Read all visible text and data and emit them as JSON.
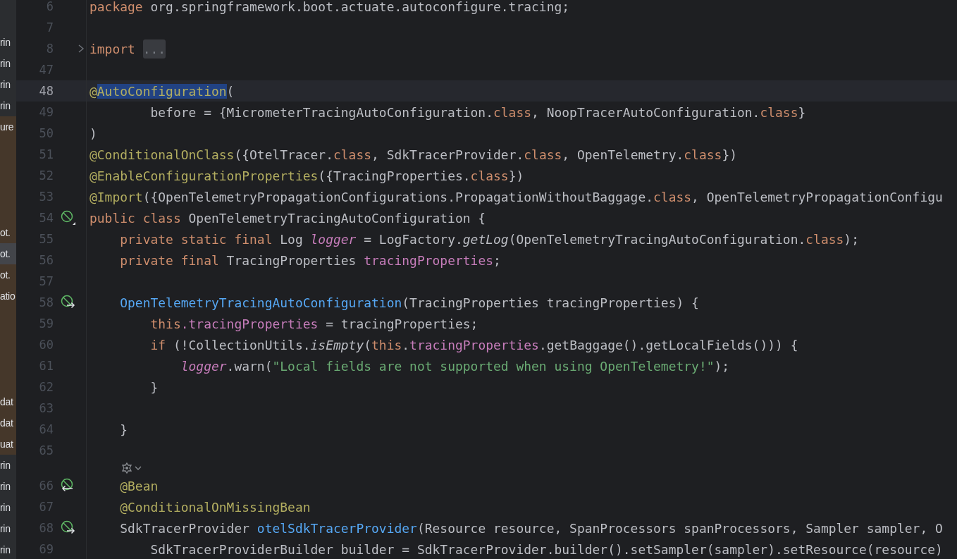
{
  "project_strip": {
    "items": [
      {
        "tinted": false,
        "selected": false
      },
      {
        "tinted": false,
        "selected": false
      },
      {
        "text": "rin",
        "tinted": false,
        "selected": false
      },
      {
        "text": "rin",
        "tinted": false,
        "selected": false
      },
      {
        "text": "rin",
        "tinted": false,
        "selected": false
      },
      {
        "text": "rin",
        "tinted": false,
        "selected": false
      },
      {
        "text": "ure",
        "tinted": true,
        "selected": false
      },
      {
        "tinted": true,
        "selected": false
      },
      {
        "tinted": true,
        "selected": false
      },
      {
        "tinted": true,
        "selected": false
      },
      {
        "tinted": true,
        "selected": false
      },
      {
        "text": "ot.",
        "tinted": true,
        "selected": false
      },
      {
        "text": "ot.",
        "tinted": true,
        "selected": true
      },
      {
        "text": "ot.",
        "tinted": true,
        "selected": false
      },
      {
        "text": "atio",
        "tinted": true,
        "selected": false
      },
      {
        "tinted": true,
        "selected": false
      },
      {
        "tinted": true,
        "selected": false
      },
      {
        "tinted": true,
        "selected": false
      },
      {
        "tinted": true,
        "selected": false
      },
      {
        "text": "dat",
        "tinted": true,
        "selected": false
      },
      {
        "text": "dat",
        "tinted": true,
        "selected": false
      },
      {
        "text": "uat",
        "tinted": true,
        "selected": false
      },
      {
        "text": "rin",
        "tinted": false,
        "selected": false
      },
      {
        "text": "rin",
        "tinted": false,
        "selected": false
      },
      {
        "text": "rin",
        "tinted": false,
        "selected": false
      },
      {
        "text": "rin",
        "tinted": false,
        "selected": false
      },
      {
        "text": "rin",
        "tinted": false,
        "selected": false
      }
    ]
  },
  "editor": {
    "lines": [
      {
        "kind": "code",
        "number": "6",
        "current": false,
        "tokens": [
          {
            "text": "package ",
            "kind": "kw"
          },
          {
            "text": "org.springframework.boot.actuate.autoconfigure.tracing;",
            "kind": "plain"
          }
        ]
      },
      {
        "kind": "code",
        "number": "7",
        "current": false
      },
      {
        "kind": "code",
        "number": "8",
        "current": false,
        "folded": true,
        "tokens": [
          {
            "text": "import ",
            "kind": "kw"
          },
          {
            "text": "...",
            "kind": "fold"
          }
        ]
      },
      {
        "kind": "code",
        "number": "47",
        "current": false
      },
      {
        "kind": "code",
        "number": "48",
        "current": true,
        "tokens": [
          {
            "text": "@",
            "kind": "ann"
          },
          {
            "text": "AutoConfiguration",
            "kind": "ann",
            "selected": true
          },
          {
            "text": "(",
            "kind": "plain"
          }
        ]
      },
      {
        "kind": "code",
        "number": "49",
        "current": false,
        "tokens": [
          {
            "text": "        before = {MicrometerTracingAutoConfiguration.",
            "kind": "plain"
          },
          {
            "text": "class",
            "kind": "kw"
          },
          {
            "text": ", NoopTracerAutoConfiguration.",
            "kind": "plain"
          },
          {
            "text": "class",
            "kind": "kw"
          },
          {
            "text": "}",
            "kind": "plain"
          }
        ]
      },
      {
        "kind": "code",
        "number": "50",
        "current": false,
        "tokens": [
          {
            "text": ")",
            "kind": "plain"
          }
        ]
      },
      {
        "kind": "code",
        "number": "51",
        "current": false,
        "tokens": [
          {
            "text": "@ConditionalOnClass",
            "kind": "ann"
          },
          {
            "text": "({OtelTracer.",
            "kind": "plain"
          },
          {
            "text": "class",
            "kind": "kw"
          },
          {
            "text": ", SdkTracerProvider.",
            "kind": "plain"
          },
          {
            "text": "class",
            "kind": "kw"
          },
          {
            "text": ", OpenTelemetry.",
            "kind": "plain"
          },
          {
            "text": "class",
            "kind": "kw"
          },
          {
            "text": "})",
            "kind": "plain"
          }
        ]
      },
      {
        "kind": "code",
        "number": "52",
        "current": false,
        "tokens": [
          {
            "text": "@EnableConfigurationProperties",
            "kind": "ann"
          },
          {
            "text": "({TracingProperties.",
            "kind": "plain"
          },
          {
            "text": "class",
            "kind": "kw"
          },
          {
            "text": "})",
            "kind": "plain"
          }
        ]
      },
      {
        "kind": "code",
        "number": "53",
        "current": false,
        "tokens": [
          {
            "text": "@Import",
            "kind": "ann"
          },
          {
            "text": "({OpenTelemetryPropagationConfigurations.PropagationWithoutBaggage.",
            "kind": "plain"
          },
          {
            "text": "class",
            "kind": "kw"
          },
          {
            "text": ", OpenTelemetryPropagationConfigu",
            "kind": "plain"
          }
        ]
      },
      {
        "kind": "code",
        "number": "54",
        "current": false,
        "gutter": {
          "kind": "bean"
        },
        "tokens": [
          {
            "text": "public class ",
            "kind": "kw"
          },
          {
            "text": "OpenTelemetryTracingAutoConfiguration {",
            "kind": "plain"
          }
        ]
      },
      {
        "kind": "code",
        "number": "55",
        "current": false,
        "tokens": [
          {
            "text": "    private static final ",
            "kind": "kw"
          },
          {
            "text": "Log ",
            "kind": "plain"
          },
          {
            "text": "logger",
            "kind": "static_field"
          },
          {
            "text": " = LogFactory.",
            "kind": "plain"
          },
          {
            "text": "getLog",
            "kind": "static_call"
          },
          {
            "text": "(OpenTelemetryTracingAutoConfiguration.",
            "kind": "plain"
          },
          {
            "text": "class",
            "kind": "kw"
          },
          {
            "text": ");",
            "kind": "plain"
          }
        ]
      },
      {
        "kind": "code",
        "number": "56",
        "current": false,
        "tokens": [
          {
            "text": "    private final ",
            "kind": "kw"
          },
          {
            "text": "TracingProperties ",
            "kind": "plain"
          },
          {
            "text": "tracingProperties",
            "kind": "field"
          },
          {
            "text": ";",
            "kind": "plain"
          }
        ]
      },
      {
        "kind": "code",
        "number": "57",
        "current": false
      },
      {
        "kind": "code",
        "number": "58",
        "current": false,
        "gutter": {
          "kind": "bean_out"
        },
        "tokens": [
          {
            "text": "    OpenTelemetryTracingAutoConfiguration",
            "kind": "decl"
          },
          {
            "text": "(TracingProperties tracingProperties) {",
            "kind": "plain"
          }
        ]
      },
      {
        "kind": "code",
        "number": "59",
        "current": false,
        "tokens": [
          {
            "text": "        this",
            "kind": "kw"
          },
          {
            "text": ".tracingProperties",
            "kind": "field"
          },
          {
            "text": " = tracingProperties;",
            "kind": "plain"
          }
        ]
      },
      {
        "kind": "code",
        "number": "60",
        "current": false,
        "tokens": [
          {
            "text": "        if ",
            "kind": "kw"
          },
          {
            "text": "(!CollectionUtils.",
            "kind": "plain"
          },
          {
            "text": "isEmpty",
            "kind": "static_call"
          },
          {
            "text": "(",
            "kind": "plain"
          },
          {
            "text": "this",
            "kind": "kw"
          },
          {
            "text": ".",
            "kind": "plain"
          },
          {
            "text": "tracingProperties",
            "kind": "field"
          },
          {
            "text": ".getBaggage().getLocalFields())) {",
            "kind": "plain"
          }
        ]
      },
      {
        "kind": "code",
        "number": "61",
        "current": false,
        "tokens": [
          {
            "text": "            logger",
            "kind": "static_field"
          },
          {
            "text": ".warn(",
            "kind": "plain"
          },
          {
            "text": "\"Local fields are not supported when using OpenTelemetry!\"",
            "kind": "str"
          },
          {
            "text": ");",
            "kind": "plain"
          }
        ]
      },
      {
        "kind": "code",
        "number": "62",
        "current": false,
        "tokens": [
          {
            "text": "        }",
            "kind": "plain"
          }
        ]
      },
      {
        "kind": "code",
        "number": "63",
        "current": false
      },
      {
        "kind": "code",
        "number": "64",
        "current": false,
        "tokens": [
          {
            "text": "    }",
            "kind": "plain"
          }
        ]
      },
      {
        "kind": "code",
        "number": "65",
        "current": false
      },
      {
        "kind": "inlay"
      },
      {
        "kind": "code",
        "number": "66",
        "current": false,
        "gutter": {
          "kind": "bean_in"
        },
        "tokens": [
          {
            "text": "    @Bean",
            "kind": "ann"
          }
        ]
      },
      {
        "kind": "code",
        "number": "67",
        "current": false,
        "tokens": [
          {
            "text": "    @ConditionalOnMissingBean",
            "kind": "ann"
          }
        ]
      },
      {
        "kind": "code",
        "number": "68",
        "current": false,
        "gutter": {
          "kind": "bean_out"
        },
        "tokens": [
          {
            "text": "    SdkTracerProvider ",
            "kind": "plain"
          },
          {
            "text": "otelSdkTracerProvider",
            "kind": "decl"
          },
          {
            "text": "(Resource resource, SpanProcessors spanProcessors, Sampler sampler, O",
            "kind": "plain"
          }
        ]
      },
      {
        "kind": "code",
        "number": "69",
        "current": false,
        "tokens": [
          {
            "text": "        SdkTracerProviderBuilder builder = SdkTracerProvider.builder().setSampler(sampler).setResource(resource)",
            "kind": "plain"
          }
        ]
      }
    ]
  }
}
